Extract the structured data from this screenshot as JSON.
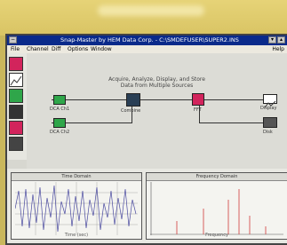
{
  "window": {
    "title": "Snap-Master by HEM Data Corp. - C:\\SMDEFUSER\\SUPER2.INS"
  },
  "menu": {
    "items": [
      "File",
      "Channel",
      "Diff",
      "Options",
      "Window"
    ],
    "help": "Help"
  },
  "canvas": {
    "caption_line1": "Acquire, Analyze, Display, and Store",
    "caption_line2": "Data from Multiple Sources"
  },
  "blocks": [
    {
      "label": "DCA Ch1"
    },
    {
      "label": "DCA Ch2"
    },
    {
      "label": "Combine"
    },
    {
      "label": "FFT"
    },
    {
      "label": "Display"
    },
    {
      "label": "Disk"
    }
  ],
  "panels": {
    "left_title": "Time Domain",
    "right_title": "Frequency Domain",
    "left_xlabel": "Time (sec)",
    "right_xlabel": "Frequency"
  },
  "colors": {
    "acquire_block": "#2fa64a",
    "combine_block": "#2a3f55",
    "fft_block": "#d2245c",
    "spectrum_line": "#d23a3a",
    "signal_line": "#4a4aa0"
  }
}
